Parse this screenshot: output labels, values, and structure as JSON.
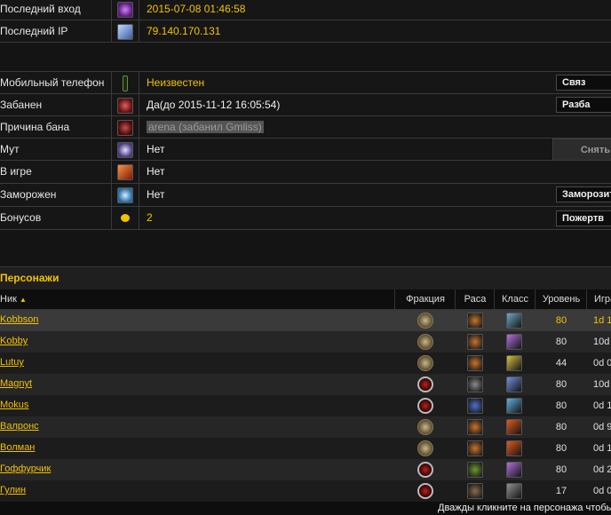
{
  "account": {
    "last_login_label": "Последний вход",
    "last_login_value": "2015-07-08 01:46:58",
    "last_ip_label": "Последний IP",
    "last_ip_value": "79.140.170.131",
    "phone_label": "Мобильный телефон",
    "phone_value": "Неизвестен",
    "phone_button": "Связ",
    "banned_label": "Забанен",
    "banned_value": "Да(до 2015-11-12 16:05:54)",
    "banned_button": "Разба",
    "ban_reason_label": "Причина бана",
    "ban_reason_value": "arena (забанил Gmliss)",
    "mute_label": "Мут",
    "mute_value": "Нет",
    "mute_button": "Снять",
    "ingame_label": "В игре",
    "ingame_value": "Нет",
    "frozen_label": "Заморожен",
    "frozen_value": "Нет",
    "frozen_button": "Заморозит",
    "bonus_label": "Бонусов",
    "bonus_value": "2",
    "bonus_button": "Пожертв"
  },
  "characters": {
    "title": "Персонажи",
    "columns": {
      "name": "Ник",
      "faction": "Фракция",
      "race": "Раса",
      "class": "Класс",
      "level": "Уровень",
      "time": "Игра"
    },
    "rows": [
      {
        "name": "Kobbson",
        "faction": "alliance",
        "race_color": "#c9742a",
        "class_color": "#6fa8c8",
        "level": "80",
        "time": "1d 1",
        "highlight": true
      },
      {
        "name": "Kobby",
        "faction": "alliance",
        "race_color": "#c9742a",
        "class_color": "#b070e0",
        "level": "80",
        "time": "10d",
        "highlight": false
      },
      {
        "name": "Lutuy",
        "faction": "alliance",
        "race_color": "#c9742a",
        "class_color": "#d8c040",
        "level": "44",
        "time": "0d 0",
        "highlight": false
      },
      {
        "name": "Magnyt",
        "faction": "horde",
        "race_color": "#8a8a8a",
        "class_color": "#7090e0",
        "level": "80",
        "time": "10d",
        "highlight": false
      },
      {
        "name": "Mokus",
        "faction": "horde",
        "race_color": "#4a70d0",
        "class_color": "#60b0e0",
        "level": "80",
        "time": "0d 1",
        "highlight": false
      },
      {
        "name": "Валронс",
        "faction": "alliance",
        "race_color": "#c9742a",
        "class_color": "#e05a20",
        "level": "80",
        "time": "0d 9",
        "highlight": false
      },
      {
        "name": "Волман",
        "faction": "alliance",
        "race_color": "#c9742a",
        "class_color": "#e05a20",
        "level": "80",
        "time": "0d 1",
        "highlight": false
      },
      {
        "name": "Гоффурчик",
        "faction": "horde",
        "race_color": "#6a9a2a",
        "class_color": "#b070e0",
        "level": "80",
        "time": "0d 2",
        "highlight": false
      },
      {
        "name": "Гулин",
        "faction": "horde",
        "race_color": "#8a6a4a",
        "class_color": "#909090",
        "level": "17",
        "time": "0d 0",
        "highlight": false
      }
    ],
    "footer_hint": "Дважды кликните на персонажа чтобы"
  }
}
